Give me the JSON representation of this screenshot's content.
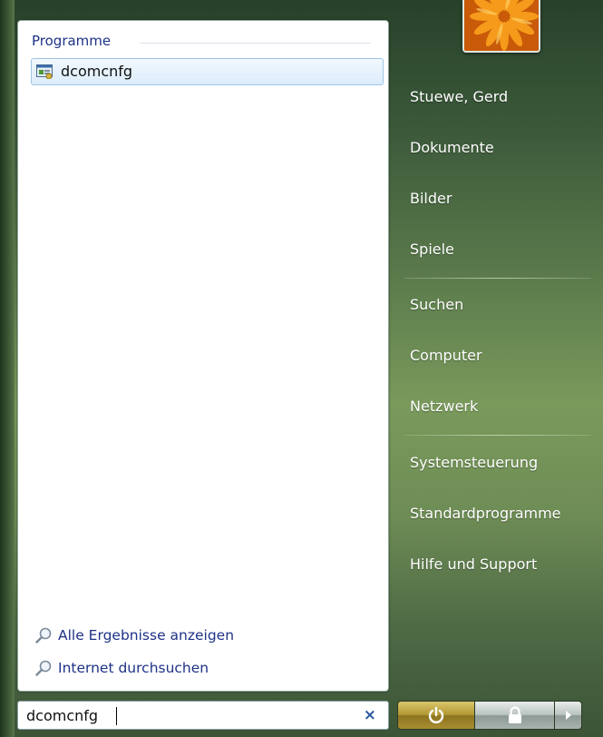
{
  "left_pane": {
    "group_header": "Programme",
    "results": [
      {
        "label": "dcomcnfg",
        "icon": "component-services-icon"
      }
    ],
    "links": [
      {
        "label": "Alle Ergebnisse anzeigen",
        "icon": "search-magnifier-icon"
      },
      {
        "label": "Internet durchsuchen",
        "icon": "search-magnifier-icon"
      }
    ]
  },
  "search": {
    "value": "dcomcnfg",
    "clear_icon": "×"
  },
  "right_pane": {
    "user_picture_icon": "user-flower-picture-icon",
    "items": [
      "Stuewe, Gerd",
      "Dokumente",
      "Bilder",
      "Spiele",
      "Suchen",
      "Computer",
      "Netzwerk",
      "Systemsteuerung",
      "Standardprogramme",
      "Hilfe und Support"
    ]
  },
  "power_buttons": {
    "power_icon": "power-icon",
    "lock_icon": "lock-icon",
    "arrow_icon": "arrow-right-icon"
  },
  "colors": {
    "link_blue": "#1e3287",
    "highlight_border": "#9fc5e6",
    "power_gold": "#b39935"
  }
}
